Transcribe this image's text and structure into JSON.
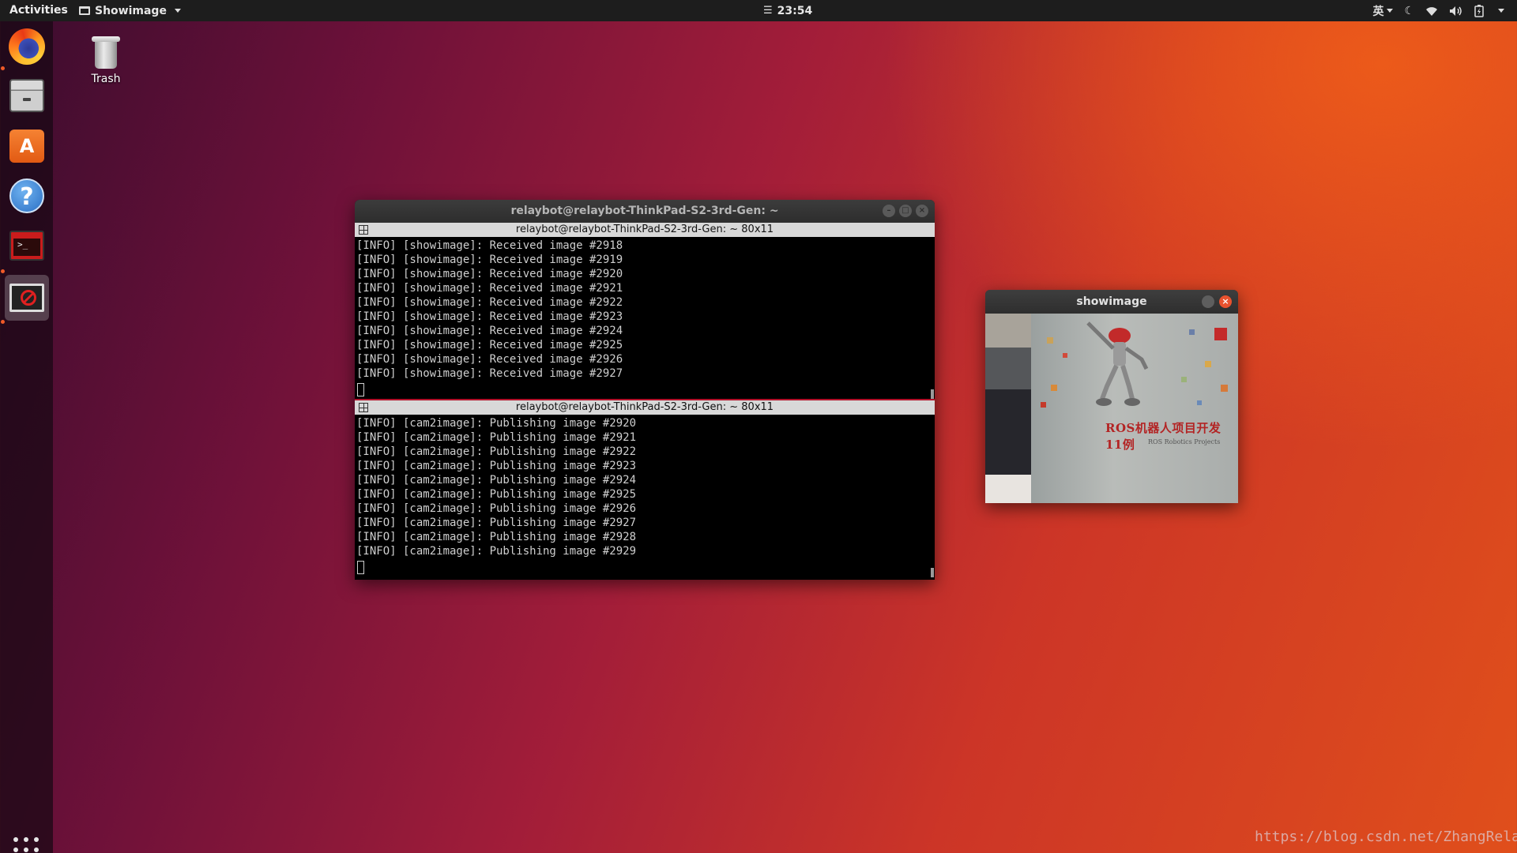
{
  "topbar": {
    "activities": "Activities",
    "app_name": "Showimage",
    "clock": "23:54",
    "ime": "英"
  },
  "dock": {
    "items": [
      "firefox-icon",
      "files-icon",
      "software-icon",
      "help-icon",
      "terminal-icon",
      "showimage-icon"
    ]
  },
  "desktop": {
    "trash_label": "Trash"
  },
  "terminal": {
    "title": "relaybot@relaybot-ThinkPad-S2-3rd-Gen: ~",
    "panes": [
      {
        "header": "relaybot@relaybot-ThinkPad-S2-3rd-Gen: ~ 80x11",
        "lines": [
          "[INFO] [showimage]: Received image #2918",
          "[INFO] [showimage]: Received image #2919",
          "[INFO] [showimage]: Received image #2920",
          "[INFO] [showimage]: Received image #2921",
          "[INFO] [showimage]: Received image #2922",
          "[INFO] [showimage]: Received image #2923",
          "[INFO] [showimage]: Received image #2924",
          "[INFO] [showimage]: Received image #2925",
          "[INFO] [showimage]: Received image #2926",
          "[INFO] [showimage]: Received image #2927"
        ]
      },
      {
        "header": "relaybot@relaybot-ThinkPad-S2-3rd-Gen: ~ 80x11",
        "lines": [
          "[INFO] [cam2image]: Publishing image #2920",
          "[INFO] [cam2image]: Publishing image #2921",
          "[INFO] [cam2image]: Publishing image #2922",
          "[INFO] [cam2image]: Publishing image #2923",
          "[INFO] [cam2image]: Publishing image #2924",
          "[INFO] [cam2image]: Publishing image #2925",
          "[INFO] [cam2image]: Publishing image #2926",
          "[INFO] [cam2image]: Publishing image #2927",
          "[INFO] [cam2image]: Publishing image #2928",
          "[INFO] [cam2image]: Publishing image #2929"
        ]
      }
    ]
  },
  "showimage": {
    "title": "showimage",
    "book_title": "ROS机器人项目开发11例",
    "book_subtitle": "ROS Robotics Projects"
  },
  "watermark": "https://blog.csdn.net/ZhangRelay",
  "colors": {
    "accent": "#e9522e",
    "topbar": "#1d1d1d",
    "terminal_bg": "#000000",
    "pane_divider": "#b3122a"
  }
}
